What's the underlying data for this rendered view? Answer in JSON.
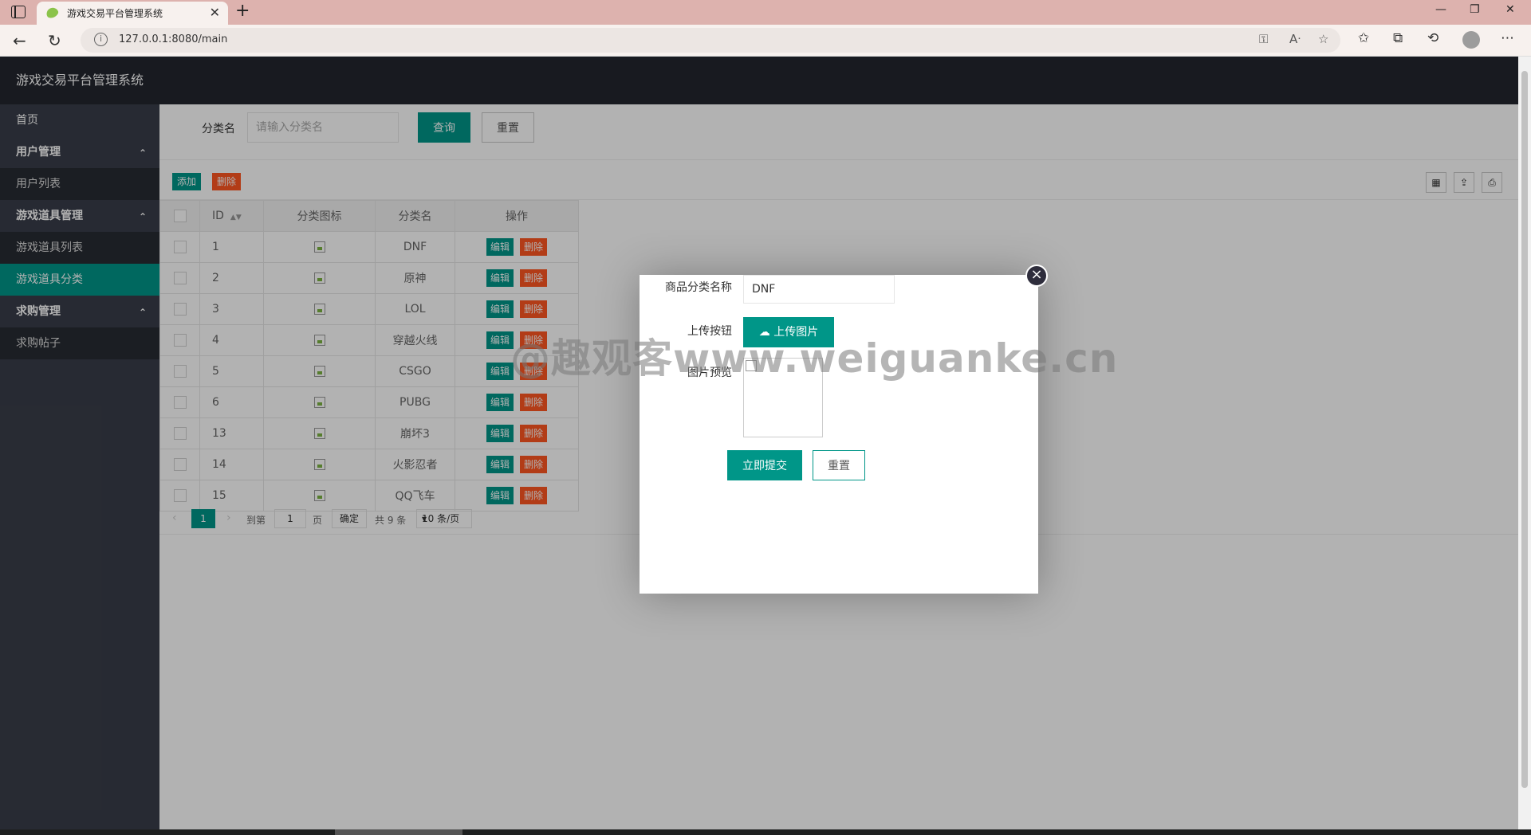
{
  "browser": {
    "tab_title": "游戏交易平台管理系统",
    "url": "127.0.0.1:8080/main",
    "tab_close": "✕",
    "new_tab": "+",
    "window_controls": [
      "—",
      "❐",
      "✕"
    ]
  },
  "sidebar": {
    "title": "游戏交易平台管理系统",
    "home": "首页",
    "groups": [
      {
        "label": "用户管理",
        "items": [
          "用户列表"
        ]
      },
      {
        "label": "游戏道具管理",
        "items": [
          "游戏道具列表",
          "游戏道具分类"
        ]
      },
      {
        "label": "求购管理",
        "items": [
          "求购帖子"
        ]
      }
    ],
    "active_item": "游戏道具分类"
  },
  "search": {
    "label": "分类名",
    "placeholder": "请输入分类名",
    "query_button": "查询",
    "reset_button": "重置"
  },
  "toolbar": {
    "add": "添加",
    "delete": "删除"
  },
  "table": {
    "headers": [
      "ID",
      "分类图标",
      "分类名",
      "操作"
    ],
    "edit_label": "编辑",
    "delete_label": "删除",
    "rows": [
      {
        "id": "1",
        "name": "DNF"
      },
      {
        "id": "2",
        "name": "原神"
      },
      {
        "id": "3",
        "name": "LOL"
      },
      {
        "id": "4",
        "name": "穿越火线"
      },
      {
        "id": "5",
        "name": "CSGO"
      },
      {
        "id": "6",
        "name": "PUBG"
      },
      {
        "id": "13",
        "name": "崩坏3"
      },
      {
        "id": "14",
        "name": "火影忍者"
      },
      {
        "id": "15",
        "name": "QQ飞车"
      }
    ]
  },
  "pager": {
    "current_page": "1",
    "goto_label": "到第",
    "page_input": "1",
    "page_unit": "页",
    "confirm": "确定",
    "total": "共 9 条",
    "page_size": "10 条/页"
  },
  "modal": {
    "name_label": "商品分类名称",
    "name_value": "DNF",
    "upload_label": "上传按钮",
    "upload_button": "上传图片",
    "preview_label": "图片预览",
    "submit_button": "立即提交",
    "reset_button": "重置"
  },
  "watermark": "@趣观客www.weiguanke.cn",
  "colors": {
    "primary": "#009688",
    "danger": "#ff5722",
    "sidebar_bg": "#393d49",
    "header_bg": "#23262e"
  }
}
